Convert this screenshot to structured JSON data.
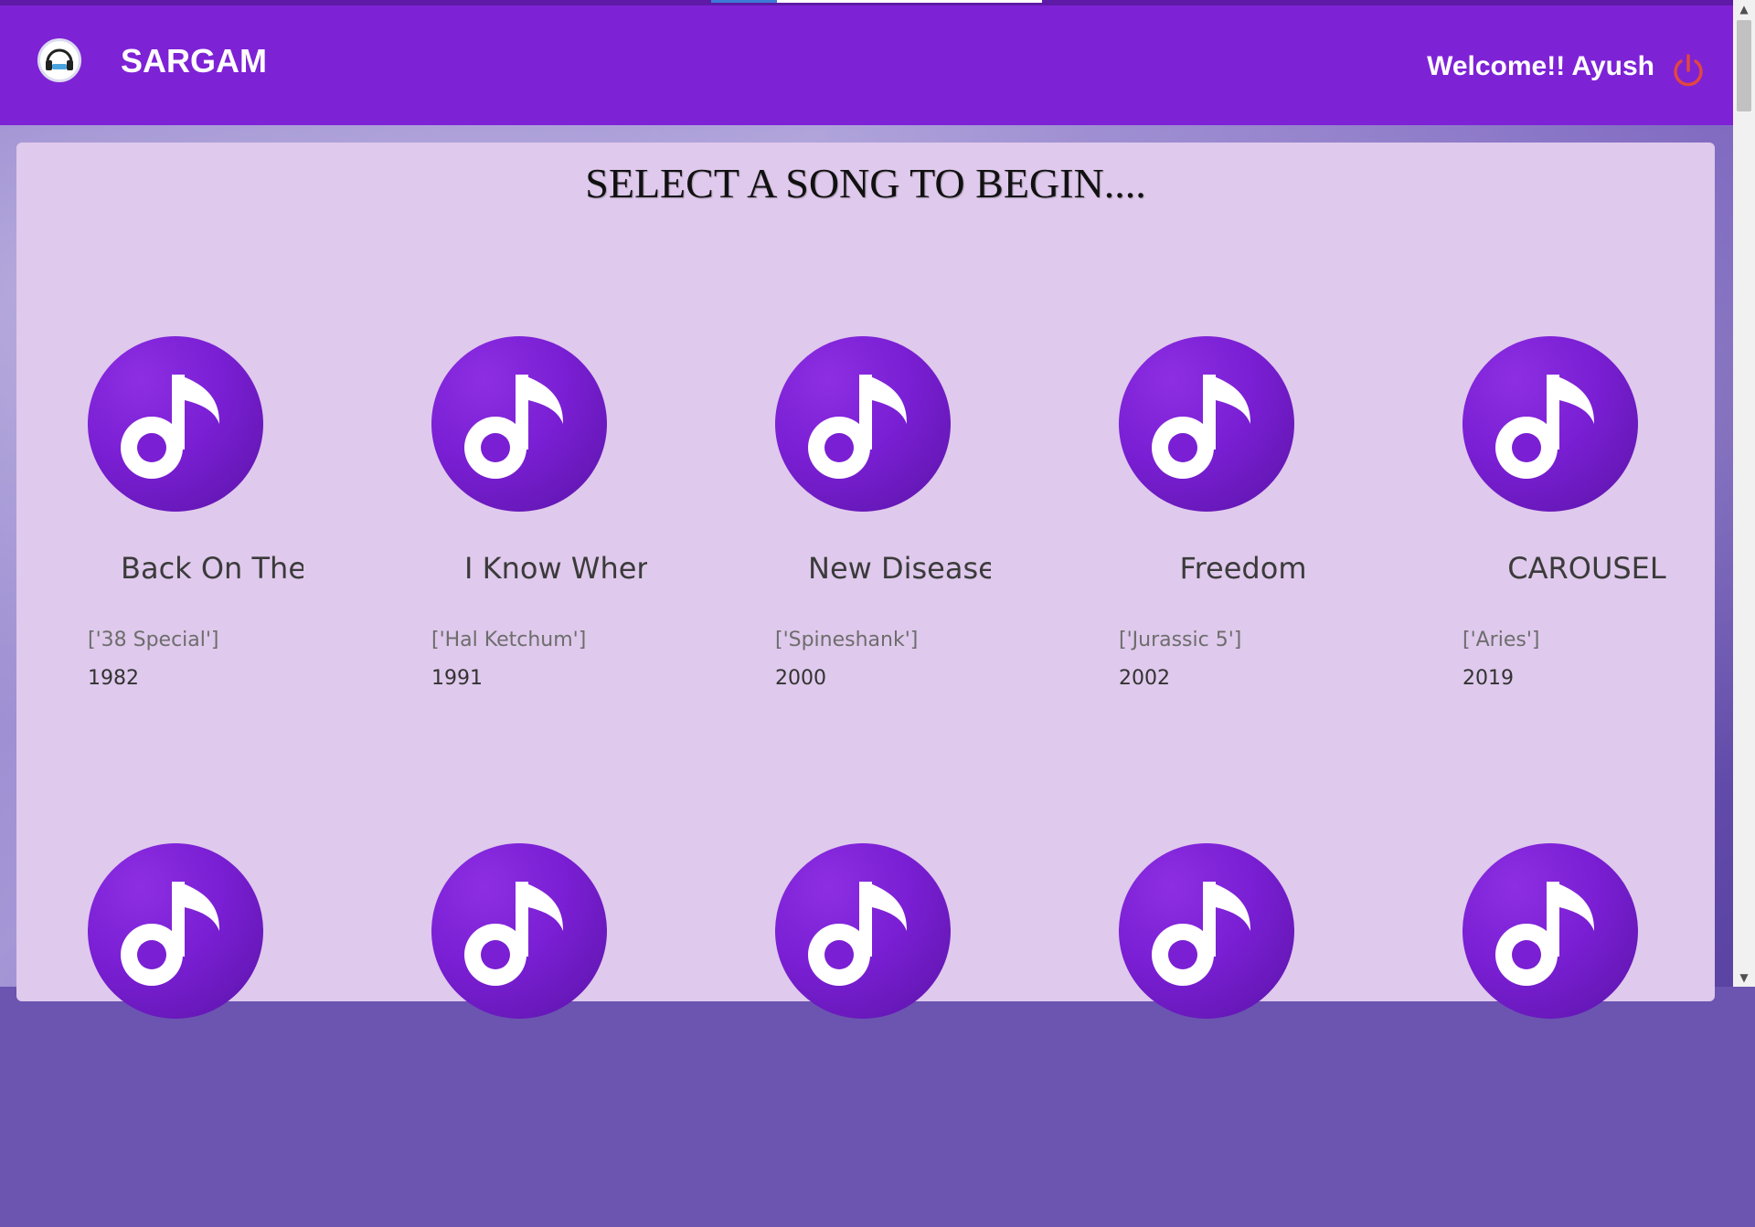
{
  "app": {
    "brand": "SARGAM",
    "welcome": "Welcome!! Ayush",
    "logo_icon": "headphones-logo-icon",
    "logout_icon": "power-icon",
    "colors": {
      "navbar": "#7e22d6",
      "panel": "#dfc9ec",
      "disc": "#7a1fd4",
      "logout": "#e0473f"
    }
  },
  "main": {
    "title": "SELECT A SONG TO BEGIN...."
  },
  "songs": [
    {
      "title": "Back On The",
      "artist": "['38 Special']",
      "year": "1982"
    },
    {
      "title": "I Know Wher",
      "artist": "['Hal Ketchum']",
      "year": "1991"
    },
    {
      "title": "New Disease",
      "artist": "['Spineshank']",
      "year": "2000"
    },
    {
      "title": "Freedom",
      "artist": "['Jurassic 5']",
      "year": "2002"
    },
    {
      "title": "CAROUSEL",
      "artist": "['Aries']",
      "year": "2019"
    }
  ],
  "second_row_count_visible": 5
}
